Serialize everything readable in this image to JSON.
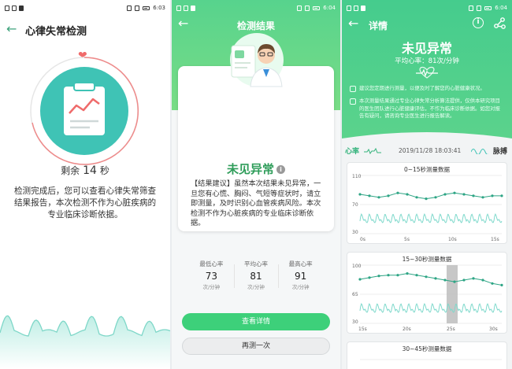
{
  "colors": {
    "accent": "#3dd07a",
    "heart": "#f06a6a",
    "teal": "#3fc3b5",
    "wave": "#7ed7c8"
  },
  "statusbar": {
    "time1": "6:03",
    "time2": "6:04",
    "time3": "6:04"
  },
  "screen1": {
    "title": "心律失常检测",
    "remaining_prefix": "剩余",
    "remaining_value": "14",
    "remaining_unit": "秒",
    "description": "检测完成后，您可以查看心律失常筛查结果报告，本次检测不作为心脏疾病的专业临床诊断依据。"
  },
  "screen2": {
    "title": "检测结果",
    "result": "未见异常",
    "advice": "【结果建议】虽然本次结果未见异常，一旦您有心慌、胸闷、气短等症状时，请立即测量，及时识别心血管疾病风险。本次检测不作为心脏疾病的专业临床诊断依据。",
    "stats": [
      {
        "label": "最低心率",
        "value": "73",
        "unit": "次/分钟"
      },
      {
        "label": "平均心率",
        "value": "81",
        "unit": "次/分钟"
      },
      {
        "label": "最高心率",
        "value": "91",
        "unit": "次/分钟"
      }
    ],
    "primary_button": "查看详情",
    "secondary_button": "再测一次"
  },
  "screen3": {
    "title": "详情",
    "result": "未见异常",
    "avg_prefix": "平均心率：",
    "avg_value": "81次/分钟",
    "note1": "建议您定期进行测量，以便及时了解您的心脏健康状况。",
    "note2": "本次测量结果通过专业心律失常分析算法提供，仅供本研究项目的医生团队进行心脏健康评估，不作为临床诊断依据。如您对报告有疑问，请咨询专业医生进行报告解读。",
    "tab_left": "心率",
    "date": "2019/11/28 18:03:41",
    "tab_right": "脉搏",
    "charts": [
      {
        "title": "0~15秒测量数据",
        "ymax": "110",
        "ymid": "70",
        "ymin": "30",
        "xticks": [
          "0s",
          "5s",
          "10s",
          "15s"
        ]
      },
      {
        "title": "15~30秒测量数据",
        "ymax": "100",
        "ymid": "65",
        "ymin": "30",
        "xticks": [
          "15s",
          "20s",
          "25s",
          "30s"
        ]
      },
      {
        "title": "30~45秒测量数据"
      }
    ]
  },
  "chart_data": [
    {
      "type": "line",
      "title": "0~15秒测量数据",
      "ylim": [
        30,
        110
      ],
      "xlim": [
        0,
        15
      ],
      "xticks": [
        0,
        5,
        10,
        15
      ],
      "series": [
        {
          "x": [
            0,
            1,
            2,
            3,
            4,
            5,
            6,
            7,
            8,
            9,
            10,
            11,
            12,
            13,
            14,
            15
          ],
          "values": [
            84,
            82,
            80,
            82,
            86,
            84,
            80,
            78,
            80,
            84,
            86,
            84,
            82,
            80,
            82,
            82
          ]
        }
      ]
    },
    {
      "type": "line",
      "title": "15~30秒测量数据",
      "ylim": [
        30,
        100
      ],
      "xlim": [
        15,
        30
      ],
      "xticks": [
        15,
        20,
        25,
        30
      ],
      "series": [
        {
          "x": [
            15,
            16,
            17,
            18,
            19,
            20,
            21,
            22,
            23,
            24,
            25,
            26,
            27,
            28,
            29,
            30
          ],
          "values": [
            83,
            85,
            87,
            88,
            88,
            90,
            88,
            86,
            84,
            82,
            80,
            82,
            84,
            82,
            78,
            76
          ]
        }
      ]
    }
  ]
}
